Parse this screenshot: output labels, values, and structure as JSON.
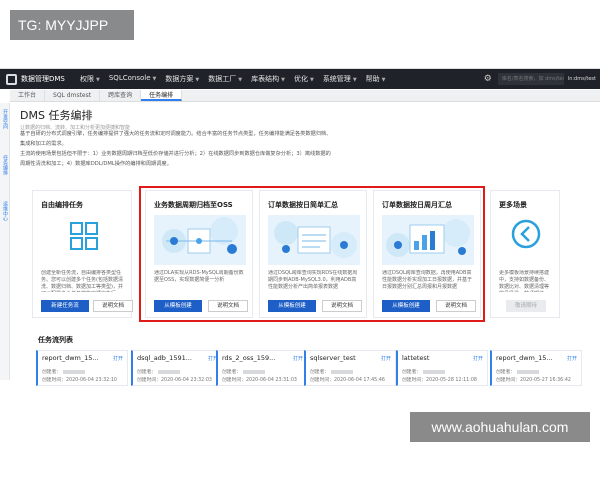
{
  "watermarks": {
    "top": "TG: MYYJJPP",
    "bottom": "www.aohuahulan.com"
  },
  "nav": {
    "brand": "数据管理DMS",
    "menu": [
      "权限",
      "SQLConsole",
      "数据方案",
      "数据工厂",
      "库表结构",
      "优化",
      "系统管理",
      "帮助"
    ],
    "search_placeholder": "库名/表名搜索，如 dms/test",
    "account": "ln:dms/test"
  },
  "tabs": [
    "工作台",
    "SQL dmstest",
    "跨库查询",
    "任务编排"
  ],
  "rail": [
    "开发空间",
    "任务编排",
    "运维中心"
  ],
  "page": {
    "title": "DMS 任务编排",
    "subtitle": "让数据的归档、流转、加工和分析更加便捷和智能",
    "desc_1": "基于自研的分布式调度引擎，任务编排提供了强大的任务流和定时调度能力。结合丰富的任务节点类型，任务编排能满足各类数据归档、",
    "desc_2": "集成和加工的需求。",
    "desc_3": "主流的使用场景包括但不限于：1）业务数据周期归档至低价存储并进行分析；2）在线数据同步到数据仓库做复杂分析；3）离线数据的",
    "desc_4": "周期性清洗和加工；4）数据库DDL/DML操作的编排和周期调度。"
  },
  "cards": [
    {
      "title": "自由编排任务",
      "desc": "创建全新任务流，自由编排各类型任务。您可以创建多个任务(包括数据清洗、数据归档、数据加工等类型)，并可以配置多个任务按指定顺序执行。",
      "primary": "新建任务流",
      "secondary": "说明文档"
    },
    {
      "title": "业务数据周期归档至OSS",
      "desc": "通过DLA实现从RDS-MySQL周期备份数据至OSS，实现数据简便一分析",
      "primary": "从模板创建",
      "secondary": "说明文档"
    },
    {
      "title": "订单数据按日简单汇总",
      "desc": "通过DSQL跨库查询实现RDS在线数据周期同步到ADB-MySQL3.0，利用ADB高性能数据分析产出简单报表数据",
      "primary": "从模板创建",
      "secondary": "说明文档"
    },
    {
      "title": "订单数据按日周月汇总",
      "desc": "通过DSQL跨库查询数据，再使用ADB高性能数据分析实现加工日报数据，并基于日报数据分别汇总周报和月报数据",
      "primary": "从模板创建",
      "secondary": "说明文档"
    },
    {
      "title": "更多场景",
      "desc": "更多模板场景持续搭建中，支持如数据备份、数据比对、数据清理等常见场景，敬请期待",
      "disabled": "敬请期待"
    }
  ],
  "flows": {
    "title": "任务流列表",
    "open_label": "打开",
    "creator_label": "创建者：",
    "time_label": "创建时间：",
    "items": [
      {
        "name": "report_dwm_15...",
        "time": "2020-06-04 23:32:10"
      },
      {
        "name": "dsql_adb_1591...",
        "time": "2020-06-04 23:32:03"
      },
      {
        "name": "rds_2_oss_159...",
        "time": "2020-06-04 23:31:03"
      },
      {
        "name": "sqlserver_test",
        "time": "2020-06-04 17:45:46"
      },
      {
        "name": "lattetest",
        "time": "2020-05-28 12:11:08"
      },
      {
        "name": "report_dwm_15...",
        "time": "2020-05-27 16:36:42"
      }
    ]
  },
  "colors": {
    "primary": "#1e5fc7",
    "highlight": "#e01919",
    "nav_bg": "#1f2329",
    "illustration_bg": "#e6f3fc"
  }
}
